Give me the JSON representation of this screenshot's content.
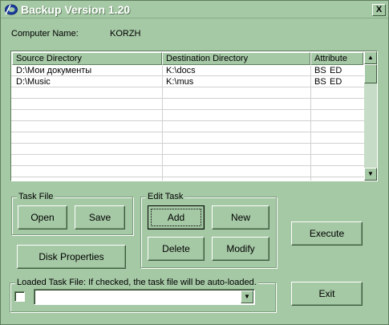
{
  "window": {
    "title": "Backup Version 1.20",
    "close_label": "X"
  },
  "computer": {
    "label": "Computer Name:",
    "value": "KORZH"
  },
  "table": {
    "columns": [
      "Source Directory",
      "Destination Directory",
      "Attribute"
    ],
    "rows": [
      {
        "source": "D:\\Мои документы",
        "destination": "K:\\docs",
        "attr1": "BS",
        "attr2": "ED"
      },
      {
        "source": "D:\\Music",
        "destination": "K:\\mus",
        "attr1": "BS",
        "attr2": "ED"
      }
    ]
  },
  "scrollbar": {
    "up_icon": "▲",
    "down_icon": "▼"
  },
  "task_file": {
    "label": "Task File",
    "open": "Open",
    "save": "Save"
  },
  "edit_task": {
    "label": "Edit Task",
    "add": "Add",
    "new": "New",
    "delete": "Delete",
    "modify": "Modify"
  },
  "buttons": {
    "disk_properties": "Disk Properties",
    "execute": "Execute",
    "exit": "Exit"
  },
  "loaded_task": {
    "label": "Loaded Task File: If checked, the task file will be auto-loaded.",
    "checked": false,
    "value": "",
    "dropdown_icon": "▼"
  }
}
